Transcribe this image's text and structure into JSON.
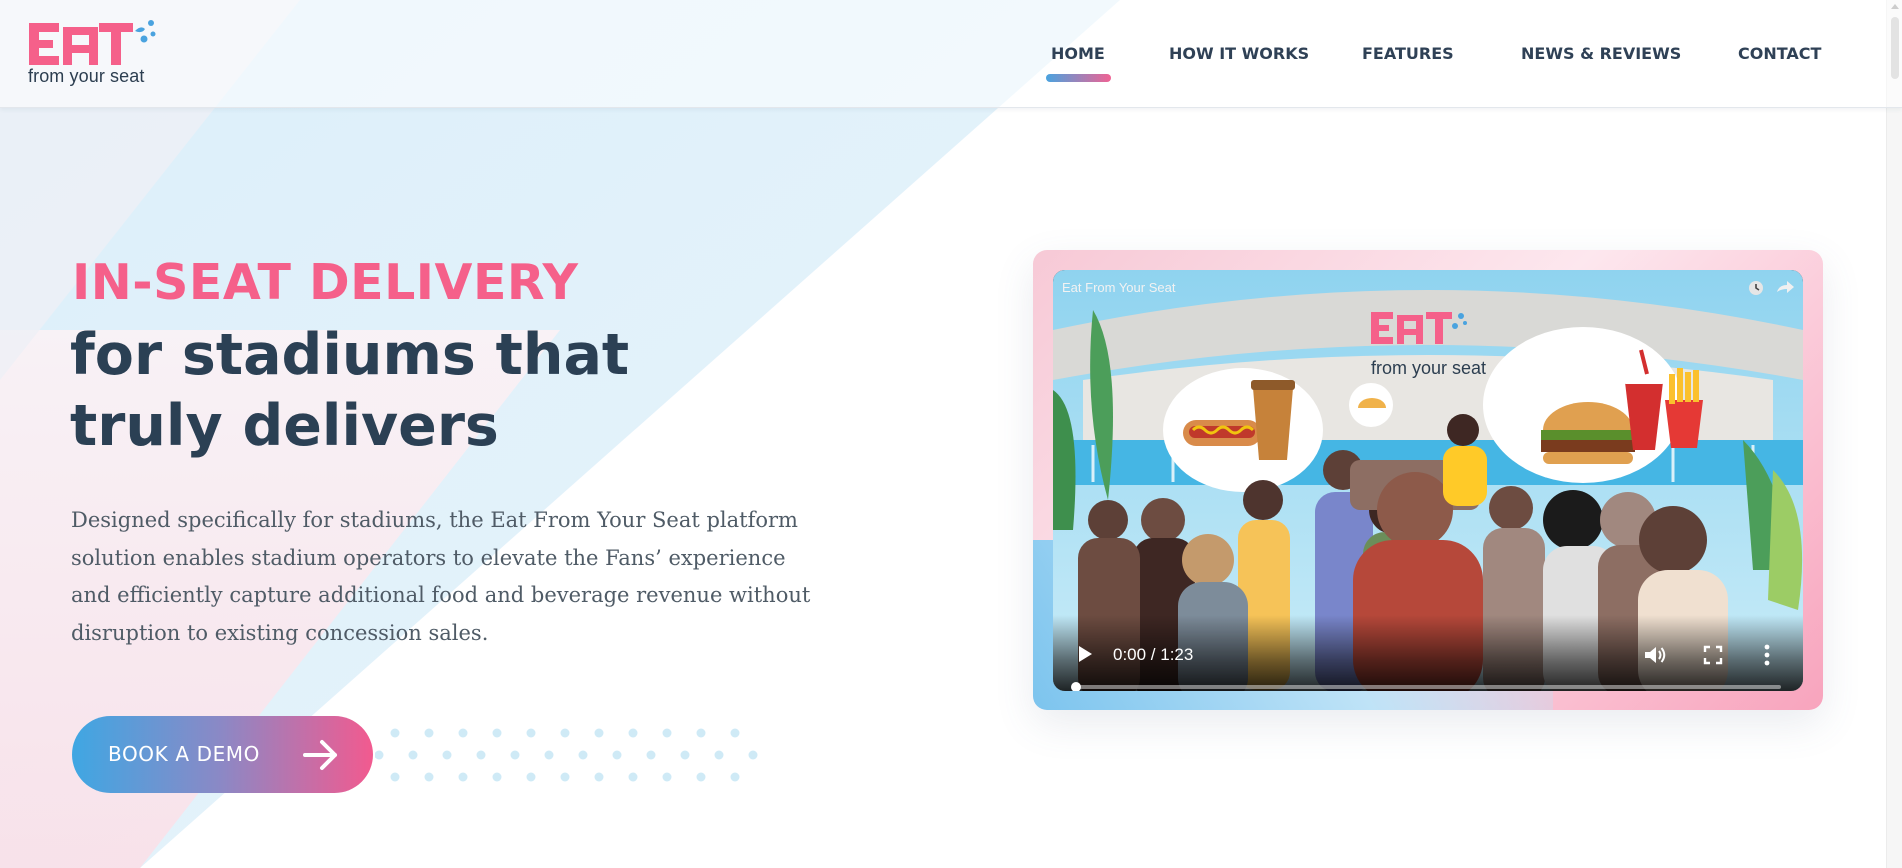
{
  "brand": {
    "logo_word": "EAT",
    "tagline": "from your seat",
    "pink": "#f5608a",
    "blue": "#4aa3df",
    "navy": "#2b4054"
  },
  "nav": {
    "items": [
      {
        "label": "HOME",
        "active": true
      },
      {
        "label": "HOW IT WORKS",
        "active": false
      },
      {
        "label": "FEATURES",
        "active": false
      },
      {
        "label": "NEWS & REVIEWS",
        "active": false
      },
      {
        "label": "CONTACT",
        "active": false
      }
    ]
  },
  "hero": {
    "kicker": "IN-SEAT DELIVERY",
    "title_line1": "for stadiums that",
    "title_line2": "truly delivers",
    "description": "Designed specifically for stadiums, the Eat From Your Seat platform solution enables stadium operators to elevate the Fans’ experience and efficiently capture additional food and beverage revenue without disruption to existing concession sales.",
    "cta_label": "BOOK A DEMO",
    "cta_icon": "arrow-right-icon"
  },
  "video": {
    "title": "Eat From Your Seat",
    "logo_word": "EAT",
    "logo_tagline": "from your seat",
    "time": "0:00 / 1:23",
    "progress": 0,
    "controls": [
      "play-icon",
      "volume-icon",
      "fullscreen-icon",
      "more-vert-icon"
    ],
    "top_icons": [
      "clock-icon",
      "share-icon"
    ]
  }
}
